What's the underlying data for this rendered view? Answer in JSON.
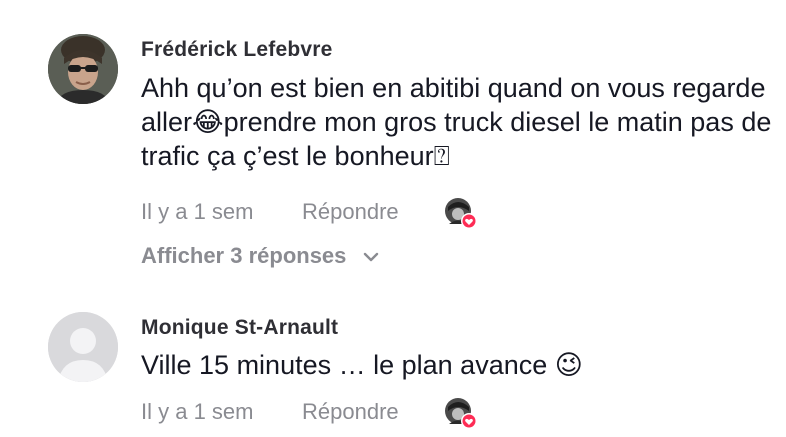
{
  "comments": [
    {
      "username": "Frédérick Lefebvre",
      "text": "Ahh qu’on est bien en abitibi quand on vous regarde aller😂prendre mon gros truck diesel le matin pas de trafic ça ç’est le bonheur⍰",
      "time": "Il y a 1 sem",
      "reply_label": "Répondre",
      "view_replies": "Afficher 3 réponses",
      "avatar_icon": "user-photo-icon",
      "creator_like_icon": "creator-liked-icon"
    },
    {
      "username": "Monique St-Arnault",
      "text": "Ville 15 minutes … le plan avance 😉",
      "time": "Il y a 1 sem",
      "reply_label": "Répondre",
      "avatar_icon": "default-avatar-icon",
      "creator_like_icon": "creator-liked-icon"
    }
  ],
  "colors": {
    "text": "#161823",
    "username": "#2f2f35",
    "muted": "#8a8b91",
    "heart": "#fe2c55",
    "default_avatar_bg": "#d9d9dc"
  }
}
